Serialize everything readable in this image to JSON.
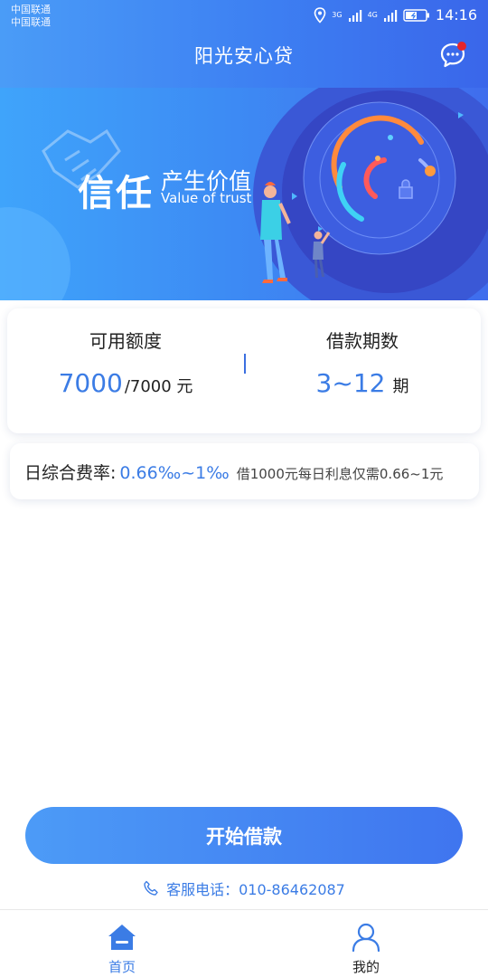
{
  "status_bar": {
    "carrier_1": "中国联通",
    "carrier_2": "中国联通",
    "net_1": "3G",
    "net_2": "4G",
    "time": "14:16"
  },
  "header": {
    "title": "阳光安心贷",
    "message_icon": "chat-bubble-icon",
    "has_notification": true
  },
  "banner": {
    "title_big": "信任",
    "title_sub": "产生价值",
    "title_en": "Value of trust"
  },
  "quota_card": {
    "available": {
      "label": "可用额度",
      "value": "7000",
      "total": "/7000 元"
    },
    "term": {
      "label": "借款期数",
      "value": "3~12",
      "unit": "期"
    }
  },
  "rate_card": {
    "label": "日综合费率:",
    "value": "0.66‰~1‰",
    "description": "借1000元每日利息仅需0.66~1元"
  },
  "actions": {
    "start_button": "开始借款",
    "service_phone": "客服电话：010-86462087"
  },
  "tab_bar": {
    "items": [
      {
        "label": "首页",
        "icon": "home-icon",
        "active": true
      },
      {
        "label": "我的",
        "icon": "user-icon",
        "active": false
      }
    ]
  },
  "colors": {
    "brand_blue": "#3b7ce5",
    "header_gradient_start": "#4a9cf7",
    "header_gradient_end": "#3a66ea",
    "notification_dot": "#e5252a"
  }
}
